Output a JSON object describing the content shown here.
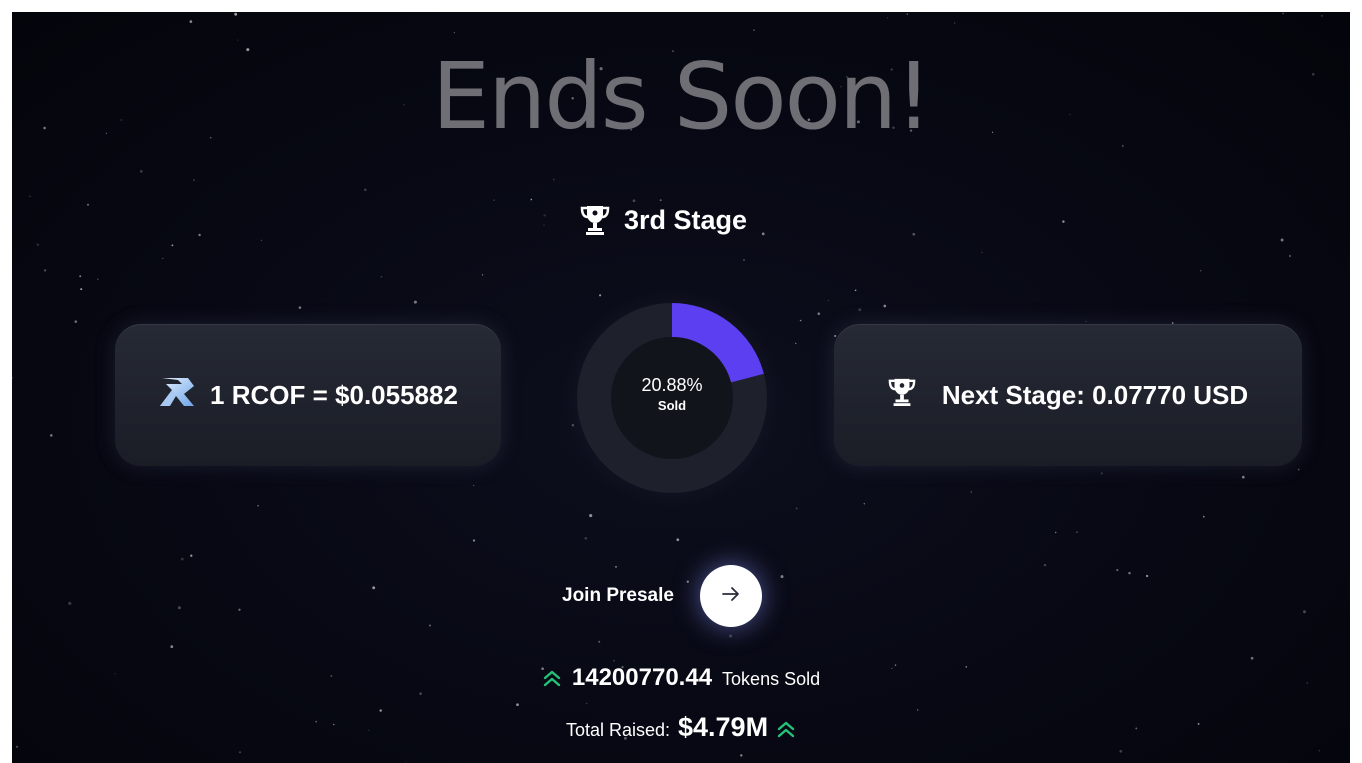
{
  "headline": "Ends Soon!",
  "stage": {
    "title": "3rd Stage",
    "icon": "trophy-icon"
  },
  "price_card": {
    "icon": "rcof-logo-icon",
    "text": "1 RCOF = $0.055882"
  },
  "progress": {
    "percent_label": "20.88%",
    "sold_label": "Sold",
    "fraction": 0.2088,
    "fill_color": "#5b3ff0",
    "track_color": "#1e212b"
  },
  "next_card": {
    "icon": "trophy-icon",
    "text": "Next Stage: 0.07770 USD"
  },
  "cta": {
    "label": "Join Presale",
    "icon": "arrow-right-icon"
  },
  "stats": {
    "tokens_value": "14200770.44",
    "tokens_label": "Tokens Sold",
    "raised_label": "Total Raised:",
    "raised_value": "$4.79M",
    "up_icon": "double-chevron-up-icon",
    "up_color": "#22c47a"
  }
}
